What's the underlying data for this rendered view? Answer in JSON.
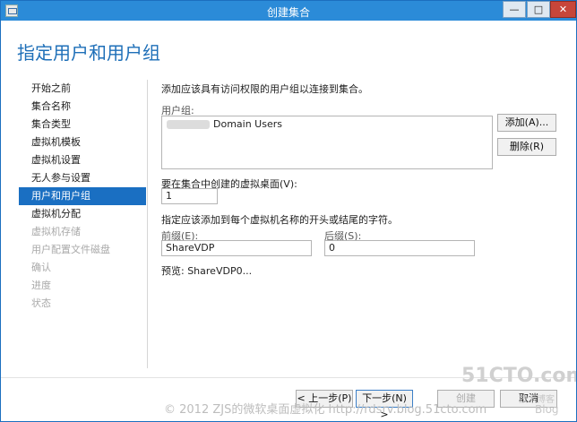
{
  "window": {
    "title": "创建集合",
    "controls": {
      "minimize": "—",
      "maximize": "□",
      "close": "✕"
    }
  },
  "page": {
    "heading": "指定用户和用户组"
  },
  "nav": {
    "items": [
      {
        "label": "开始之前",
        "state": "normal"
      },
      {
        "label": "集合名称",
        "state": "normal"
      },
      {
        "label": "集合类型",
        "state": "normal"
      },
      {
        "label": "虚拟机模板",
        "state": "normal"
      },
      {
        "label": "虚拟机设置",
        "state": "normal"
      },
      {
        "label": "无人参与设置",
        "state": "normal"
      },
      {
        "label": "用户和用户组",
        "state": "active"
      },
      {
        "label": "虚拟机分配",
        "state": "normal"
      },
      {
        "label": "虚拟机存储",
        "state": "disabled"
      },
      {
        "label": "用户配置文件磁盘",
        "state": "disabled"
      },
      {
        "label": "确认",
        "state": "disabled"
      },
      {
        "label": "进度",
        "state": "disabled"
      },
      {
        "label": "状态",
        "state": "disabled"
      }
    ]
  },
  "content": {
    "intro": "添加应该具有访问权限的用户组以连接到集合。",
    "groups_label": "用户组:",
    "groups": [
      {
        "name": "Domain Users"
      }
    ],
    "add_button": "添加(A)...",
    "remove_button": "删除(R)",
    "desktops_label": "要在集合中创建的虚拟桌面(V):",
    "desktops_value": "1",
    "naming_label": "指定应该添加到每个虚拟机名称的开头或结尾的字符。",
    "prefix_label": "前缀(E):",
    "prefix_value": "ShareVDP",
    "suffix_label": "后缀(S):",
    "suffix_value": "0",
    "preview_text": "预览: ShareVDP0..."
  },
  "footer": {
    "prev_button": "< 上一步(P)",
    "next_button": "下一步(N) >",
    "create_button": "创建",
    "cancel_button": "取消"
  },
  "watermark": {
    "text": "© 2012 ZJS的微软桌面虚拟化 http://rdsrv.blog.51cto.com",
    "logo": "51CTO.com",
    "logo_sub": "技术博客",
    "logo_blog": "Blog"
  },
  "colors": {
    "title_bar": "#2b8bd8",
    "heading": "#1e6fb8",
    "nav_active_bg": "#1a6fc2",
    "disabled_text": "#a9a9a9"
  }
}
